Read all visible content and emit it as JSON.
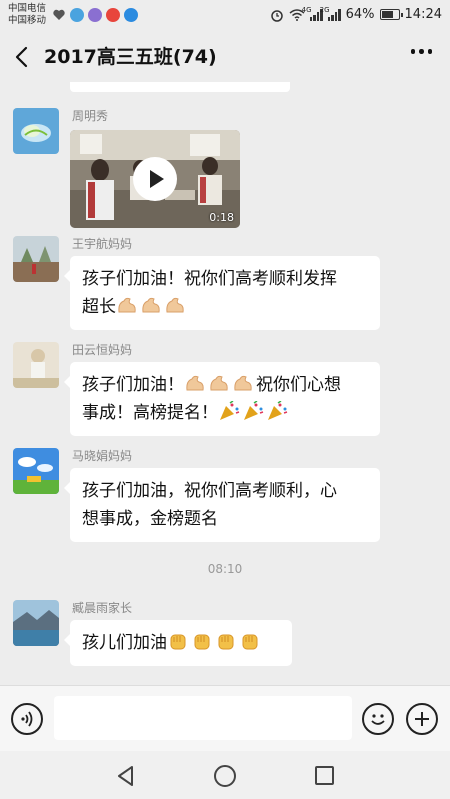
{
  "status_bar": {
    "carrier_1": "中国电信",
    "carrier_2": "中国移动",
    "network_1": "4G",
    "network_2": "2G",
    "battery": "64%",
    "time": "14:24"
  },
  "header": {
    "title": "2017高三五班(74)"
  },
  "messages": [
    {
      "sender": "周明秀",
      "type": "video",
      "duration": "0:18"
    },
    {
      "sender": "王宇航妈妈",
      "line1": "孩子们加油！祝你们高考顺利发挥",
      "line2": "超长",
      "emoji": "flexed-biceps x3"
    },
    {
      "sender": "田云恒妈妈",
      "line1a": "孩子们加油！",
      "line1b": "祝你们心想",
      "line2": "事成！高榜提名！",
      "emoji": "flexed-biceps x3, party-popper x3"
    },
    {
      "sender": "马晓娟妈妈",
      "line1": "孩子们加油，祝你们高考顺利，心",
      "line2": "想事成，金榜题名"
    },
    {
      "sender": "臧晨雨家长",
      "line1": "孩儿们加油",
      "emoji": "raised-fist x4"
    }
  ],
  "time_separator": "08:10",
  "input_bar": {
    "placeholder": "",
    "icons": [
      "voice-icon",
      "emoji-icon",
      "plus-icon"
    ]
  },
  "nav_bar": {
    "icons": [
      "back-triangle-icon",
      "home-circle-icon",
      "recent-square-icon"
    ]
  },
  "colors": {
    "background": "#ededed",
    "bubble": "#ffffff",
    "sender_text": "#888888"
  }
}
